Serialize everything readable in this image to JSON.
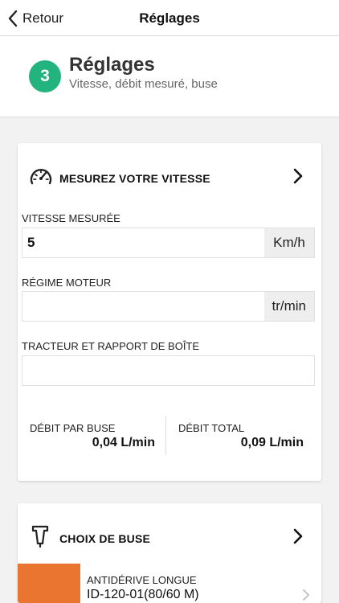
{
  "nav": {
    "back_label": "Retour",
    "title": "Réglages"
  },
  "step": {
    "number": "3",
    "title": "Réglages",
    "subtitle": "Vitesse, débit mesuré, buse",
    "color": "#23b37e"
  },
  "speed_section": {
    "icon": "speedometer-icon",
    "title": "MESUREZ VOTRE VITESSE",
    "speed": {
      "label": "VITESSE MESURÉE",
      "value": "5",
      "unit": "Km/h"
    },
    "rpm": {
      "label": "RÉGIME MOTEUR",
      "value": "",
      "unit": "tr/min"
    },
    "tractor": {
      "label": "TRACTEUR ET RAPPORT DE BOÎTE",
      "value": ""
    },
    "flow_per_nozzle": {
      "label": "DÉBIT PAR BUSE",
      "value": "0,04 L/min"
    },
    "flow_total": {
      "label": "DÉBIT TOTAL",
      "value": "0,09 L/min"
    }
  },
  "nozzle_section": {
    "icon": "nozzle-icon",
    "title": "CHOIX DE BUSE",
    "selected": {
      "type": "ANTIDÉRIVE LONGUE",
      "reference": "ID-120-01(80/60 M)",
      "color": "#ea7530"
    }
  }
}
